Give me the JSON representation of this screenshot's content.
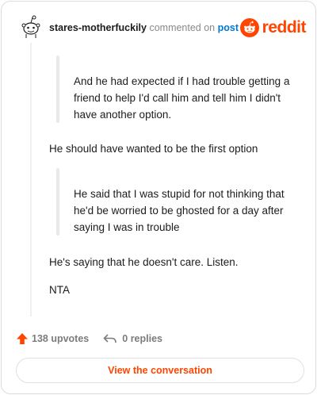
{
  "comment": {
    "username": "stares-motherfuckily",
    "action_text": "commented on",
    "target": "post"
  },
  "brand": {
    "name": "reddit",
    "color": "#ff4500",
    "icon": "reddit-snoo-icon"
  },
  "content": {
    "quote1": "And he had expected if I had trouble getting a friend to help I'd call him and tell him I didn't have another option.",
    "para1": "He should have wanted to be the first option",
    "quote2": "He said that I was stupid for not thinking that he'd be worried to be ghosted for a day after saying I was in trouble",
    "para2": "He's saying that he doesn't care. Listen.",
    "para3": "NTA"
  },
  "stats": {
    "upvotes": "138 upvotes",
    "replies": "0 replies",
    "upvote_icon": "upvote-arrow-icon",
    "reply_icon": "reply-arrow-icon"
  },
  "cta": {
    "label": "View the conversation"
  }
}
